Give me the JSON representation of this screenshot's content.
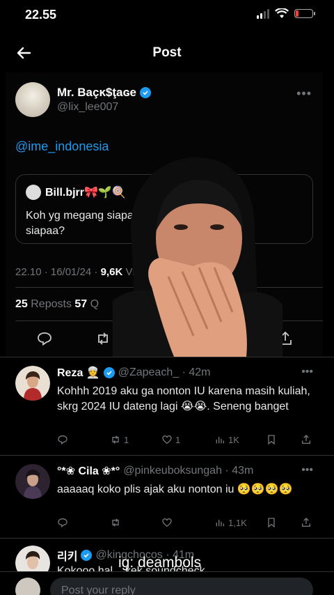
{
  "status_bar": {
    "time": "22.55"
  },
  "header": {
    "title": "Post"
  },
  "post": {
    "author_name": "Mr. Baçĸ$ţaɢe",
    "author_handle": "@lix_lee007",
    "mention": "@ime_indonesia",
    "quote": {
      "name": "Bill.bjrr🎀🌱🍭",
      "handle": "@",
      "text_start": "Koh yg megang siapa p",
      "text_end": "ma",
      "text_line2": "siapaa?"
    },
    "timestamp": "22.10 · 16/01/24 · ",
    "views_value": "9,6K",
    "views_label": " Vi",
    "reposts_count": "25",
    "reposts_label": " Reposts  ",
    "quotes_count": "57",
    "quotes_label": " Q"
  },
  "replies": [
    {
      "name": "Reza 👳",
      "handle": "@Zapeach_ · 42m",
      "text": "Kohhh 2019 aku ga nonton IU karena masih kuliah, skrg 2024 IU dateng lagi 😭😭. Seneng banget",
      "reposts": "1",
      "likes": "1",
      "views": "1K"
    },
    {
      "name": "°*❀ Cila ❀*°",
      "handle": "@pinkeuboksungah · 43m",
      "text": "aaaaaq koko plis ajak aku nonton iu 🥺🥺🥺🥺",
      "reposts": "",
      "likes": "",
      "views": "1,1K"
    },
    {
      "name": "리키",
      "handle": "@kingchocos · 41m",
      "text": "Kokooo hal...                     kek soundcheck"
    }
  ],
  "watermark": "ig: deambols",
  "reply_bar": {
    "placeholder": "Post your reply"
  },
  "colors": {
    "accent": "#1d9bf0",
    "muted": "#71767b",
    "background": "#000000"
  }
}
